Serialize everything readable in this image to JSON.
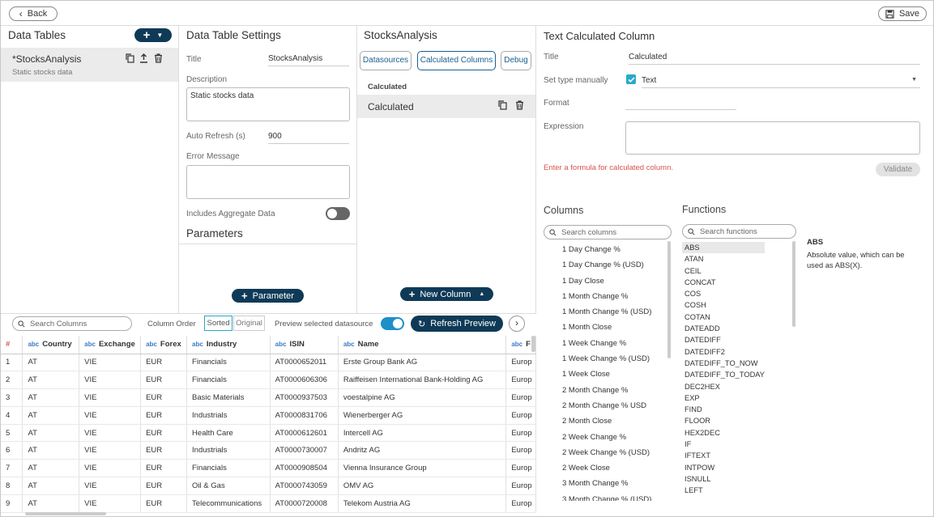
{
  "topbar": {
    "back_label": "Back",
    "save_label": "Save"
  },
  "data_tables": {
    "title": "Data Tables",
    "item_name": "*StocksAnalysis",
    "item_desc": "Static stocks data"
  },
  "settings": {
    "title": "Data Table Settings",
    "title_label": "Title",
    "title_value": "StocksAnalysis",
    "description_label": "Description",
    "description_value": "Static stocks data",
    "auto_refresh_label": "Auto Refresh (s)",
    "auto_refresh_value": "900",
    "error_label": "Error Message",
    "error_value": "",
    "aggregate_label": "Includes Aggregate Data",
    "aggregate_on": false,
    "parameters_title": "Parameters",
    "parameter_button": "Parameter"
  },
  "stocks": {
    "title": "StocksAnalysis",
    "tabs": [
      "Datasources",
      "Calculated Columns",
      "Debug"
    ],
    "active_tab": "Calculated Columns",
    "section_label": "Calculated",
    "item_name": "Calculated",
    "new_column_button": "New Column"
  },
  "calc": {
    "title": "Text Calculated Column",
    "title_label": "Title",
    "title_value": "Calculated",
    "set_type_label": "Set type manually",
    "type_value": "Text",
    "type_checked": true,
    "format_label": "Format",
    "format_value": "",
    "expression_label": "Expression",
    "expression_value": "",
    "error_text": "Enter a formula for calculated column.",
    "validate_button": "Validate",
    "columns_title": "Columns",
    "columns_search_placeholder": "Search columns",
    "columns": [
      "1 Day Change %",
      "1 Day Change % (USD)",
      "1 Day Close",
      "1 Month Change %",
      "1 Month Change % (USD)",
      "1 Month Close",
      "1 Week Change %",
      "1 Week Change % (USD)",
      "1 Week Close",
      "2 Month Change %",
      "2 Month Change % USD",
      "2 Month Close",
      "2 Week Change %",
      "2 Week Change % (USD)",
      "2 Week Close",
      "3 Month Change %",
      "3 Month Change % (USD)"
    ],
    "functions_title": "Functions",
    "functions_search_placeholder": "Search functions",
    "functions": [
      "ABS",
      "ATAN",
      "CEIL",
      "CONCAT",
      "COS",
      "COSH",
      "COTAN",
      "DATEADD",
      "DATEDIFF",
      "DATEDIFF2",
      "DATEDIFF_TO_NOW",
      "DATEDIFF_TO_TODAY",
      "DEC2HEX",
      "EXP",
      "FIND",
      "FLOOR",
      "HEX2DEC",
      "IF",
      "IFTEXT",
      "INTPOW",
      "ISNULL",
      "LEFT"
    ],
    "selected_function": "ABS",
    "help_title": "ABS",
    "help_text": "Absolute value, which can be used as ABS(X)."
  },
  "preview": {
    "search_placeholder": "Search Columns",
    "column_order_label": "Column Order",
    "sorted_label": "Sorted",
    "original_label": "Original",
    "preview_label": "Preview selected datasource",
    "preview_on": true,
    "refresh_button": "Refresh Preview",
    "headers": [
      "#",
      "Country",
      "Exchange",
      "Forex",
      "Industry",
      "ISIN",
      "Name",
      "F"
    ],
    "rows": [
      [
        "1",
        "AT",
        "VIE",
        "EUR",
        "Financials",
        "AT0000652011",
        "Erste Group Bank AG",
        "Europ"
      ],
      [
        "2",
        "AT",
        "VIE",
        "EUR",
        "Financials",
        "AT0000606306",
        "Raiffeisen International Bank-Holding AG",
        "Europ"
      ],
      [
        "3",
        "AT",
        "VIE",
        "EUR",
        "Basic Materials",
        "AT0000937503",
        "voestalpine AG",
        "Europ"
      ],
      [
        "4",
        "AT",
        "VIE",
        "EUR",
        "Industrials",
        "AT0000831706",
        "Wienerberger AG",
        "Europ"
      ],
      [
        "5",
        "AT",
        "VIE",
        "EUR",
        "Health Care",
        "AT0000612601",
        "Intercell AG",
        "Europ"
      ],
      [
        "6",
        "AT",
        "VIE",
        "EUR",
        "Industrials",
        "AT0000730007",
        "Andritz AG",
        "Europ"
      ],
      [
        "7",
        "AT",
        "VIE",
        "EUR",
        "Financials",
        "AT0000908504",
        "Vienna Insurance Group",
        "Europ"
      ],
      [
        "8",
        "AT",
        "VIE",
        "EUR",
        "Oil & Gas",
        "AT0000743059",
        "OMV AG",
        "Europ"
      ],
      [
        "9",
        "AT",
        "VIE",
        "EUR",
        "Telecommunications",
        "AT0000720008",
        "Telekom Austria AG",
        "Europ"
      ]
    ]
  },
  "colors": {
    "navy": "#0f3a57",
    "accent": "#1a5f8f",
    "toggle_on": "#1e8fc8",
    "error": "#d9534f",
    "teal_check": "#29a9c8"
  }
}
